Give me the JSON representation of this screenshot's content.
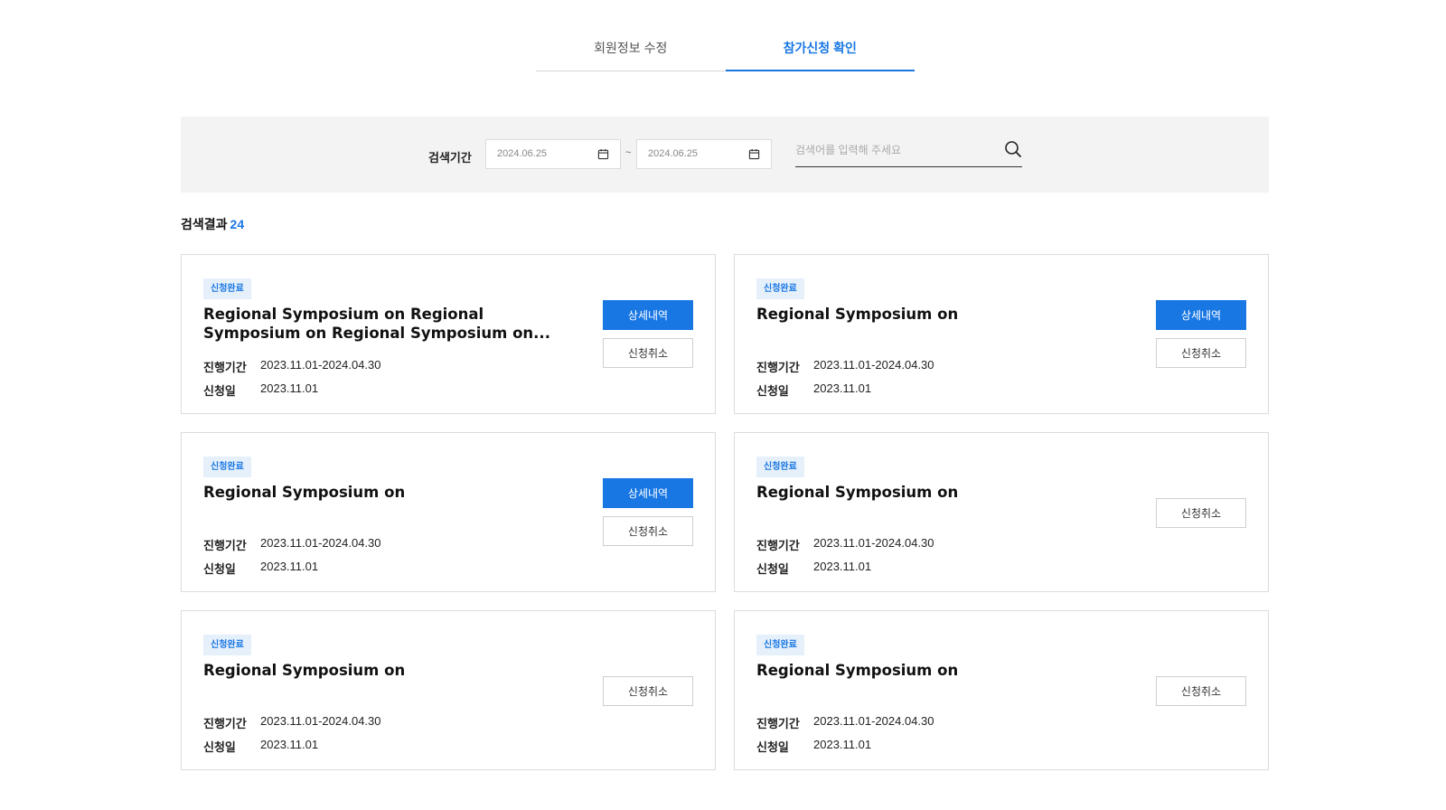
{
  "tabs": [
    {
      "label": "회원정보 수정",
      "active": false
    },
    {
      "label": "참가신청 확인",
      "active": true
    }
  ],
  "search": {
    "period_label": "검색기간",
    "date_from": "2024.06.25",
    "date_to": "2024.06.25",
    "separator": "~",
    "keyword_placeholder": "검색어를 입력해 주세요"
  },
  "results": {
    "label": "검색결과",
    "count": "24"
  },
  "labels": {
    "period": "진행기간",
    "applied": "신청일",
    "detail_button": "상세내역",
    "cancel_button": "신청취소"
  },
  "cards": [
    {
      "badge": "신청완료",
      "title": "Regional Symposium on Regional Symposium on Regional Symposium on...",
      "period": "2023.11.01-2024.04.30",
      "applied": "2023.11.01",
      "show_detail": true
    },
    {
      "badge": "신청완료",
      "title": "Regional Symposium on",
      "period": "2023.11.01-2024.04.30",
      "applied": "2023.11.01",
      "show_detail": true
    },
    {
      "badge": "신청완료",
      "title": "Regional Symposium on",
      "period": "2023.11.01-2024.04.30",
      "applied": "2023.11.01",
      "show_detail": true
    },
    {
      "badge": "신청완료",
      "title": "Regional Symposium on",
      "period": "2023.11.01-2024.04.30",
      "applied": "2023.11.01",
      "show_detail": false
    },
    {
      "badge": "신청완료",
      "title": "Regional Symposium on",
      "period": "2023.11.01-2024.04.30",
      "applied": "2023.11.01",
      "show_detail": false
    },
    {
      "badge": "신청완료",
      "title": "Regional Symposium on",
      "period": "2023.11.01-2024.04.30",
      "applied": "2023.11.01",
      "show_detail": false
    }
  ],
  "colors": {
    "accent": "#1977e4",
    "badge_bg": "#e6f0fb",
    "panel_bg": "#f3f3f4"
  }
}
